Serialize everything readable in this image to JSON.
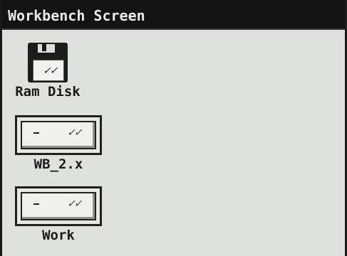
{
  "window": {
    "title": "Workbench Screen"
  },
  "icons": [
    {
      "label": "Ram Disk",
      "icon": "floppy-disk-icon"
    },
    {
      "label": "WB_2.x",
      "icon": "hard-drive-icon"
    },
    {
      "label": "Work",
      "icon": "hard-drive-icon"
    }
  ]
}
